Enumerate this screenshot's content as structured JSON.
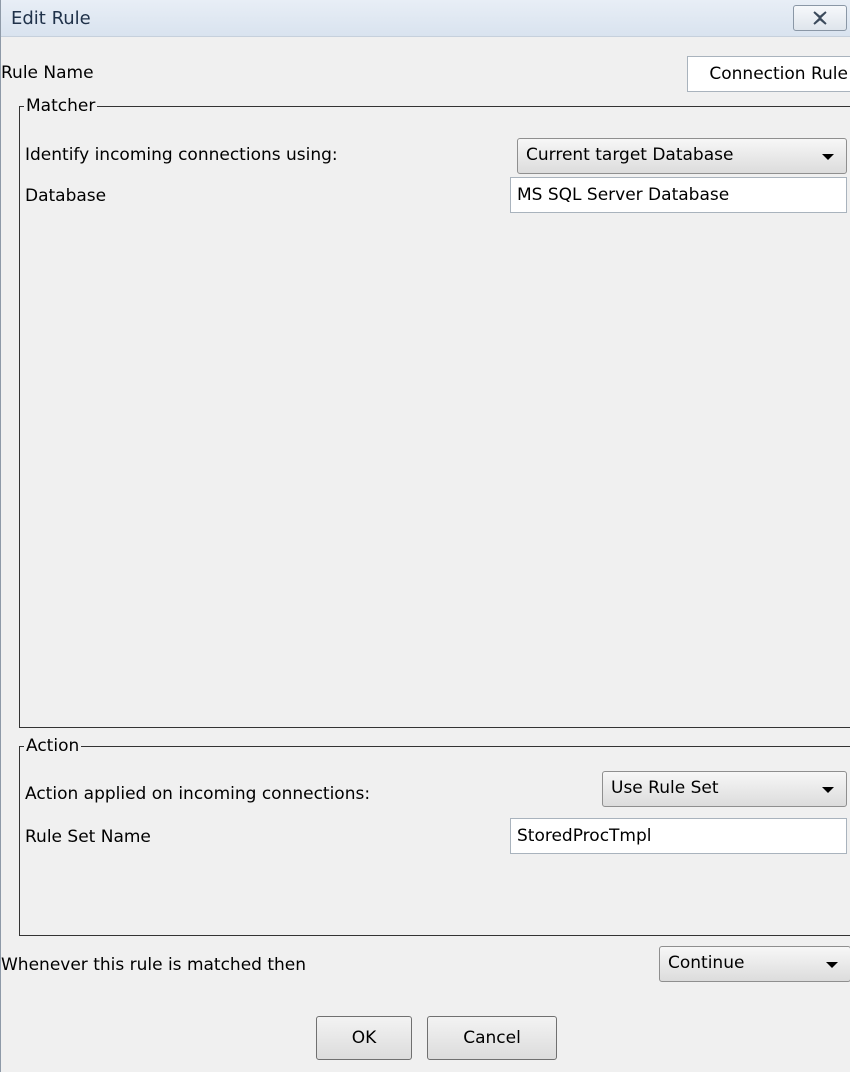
{
  "window": {
    "title": "Edit Rule"
  },
  "rule_name": {
    "label": "Rule Name",
    "value": "Connection Rule"
  },
  "matcher": {
    "group_label": "Matcher",
    "identify_label": "Identify incoming connections using:",
    "identify_selected": "Current target Database",
    "database_label": "Database",
    "database_value": "MS SQL Server Database"
  },
  "action": {
    "group_label": "Action",
    "applied_label": "Action applied on incoming connections:",
    "applied_selected": "Use Rule Set",
    "rule_set_label": "Rule Set Name",
    "rule_set_value": "StoredProcTmpl"
  },
  "matched": {
    "label": "Whenever this rule is matched then",
    "selected": "Continue"
  },
  "buttons": {
    "ok": "OK",
    "cancel": "Cancel"
  },
  "icons": {
    "close": "close-icon",
    "dropdown": "chevron-down-icon"
  }
}
